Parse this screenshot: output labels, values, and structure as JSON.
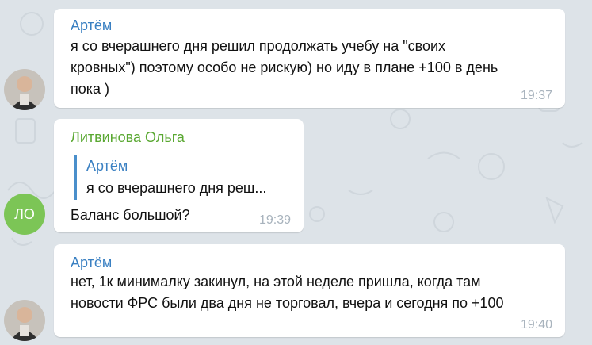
{
  "colors": {
    "background": "#dde3e8",
    "sender_artem": "#3a80c2",
    "sender_olga": "#5aa832",
    "avatar_olga": "#7cc556",
    "time": "#a8b3bd"
  },
  "messages": [
    {
      "sender": "Артём",
      "text_lines": [
        "я со вчерашнего дня решил продолжать учебу на \"своих",
        "кровных\") поэтому особо не рискую) но иду в плане +100 в день",
        "пока )"
      ],
      "time": "19:37",
      "avatar": "photo-avatar"
    },
    {
      "sender": "Литвинова Ольга",
      "reply": {
        "sender": "Артём",
        "text": "я со вчерашнего дня реш..."
      },
      "text": "Баланс большой?",
      "time": "19:39",
      "avatar_initials": "ЛО"
    },
    {
      "sender": "Артём",
      "text_lines": [
        "нет, 1к минималку закинул, на этой неделе пришла, когда там",
        "новости ФРС были два дня не торговал, вчера и сегодня по +100"
      ],
      "time": "19:40",
      "avatar": "photo-avatar"
    }
  ]
}
